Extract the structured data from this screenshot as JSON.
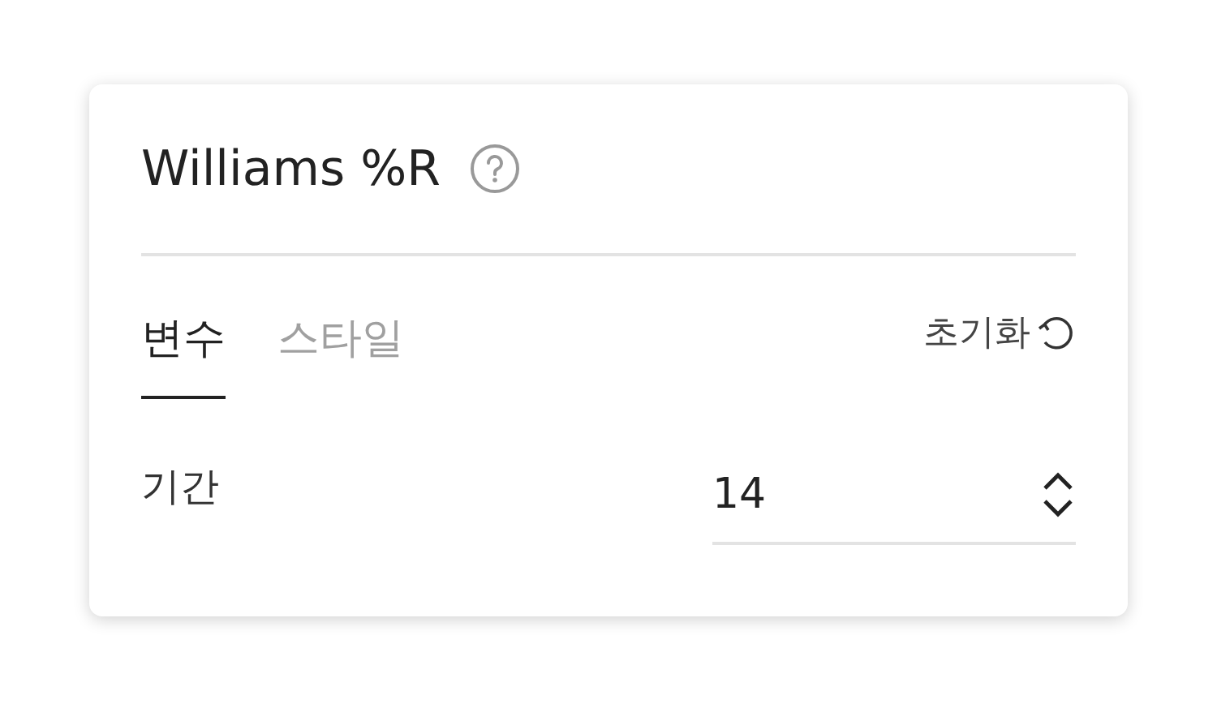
{
  "dialog": {
    "title": "Williams %R"
  },
  "tabs": [
    {
      "label": "변수",
      "selected": true
    },
    {
      "label": "스타일",
      "selected": false
    }
  ],
  "reset_button": {
    "label": "초기화"
  },
  "fields": [
    {
      "label": "기간",
      "value": "14"
    }
  ]
}
